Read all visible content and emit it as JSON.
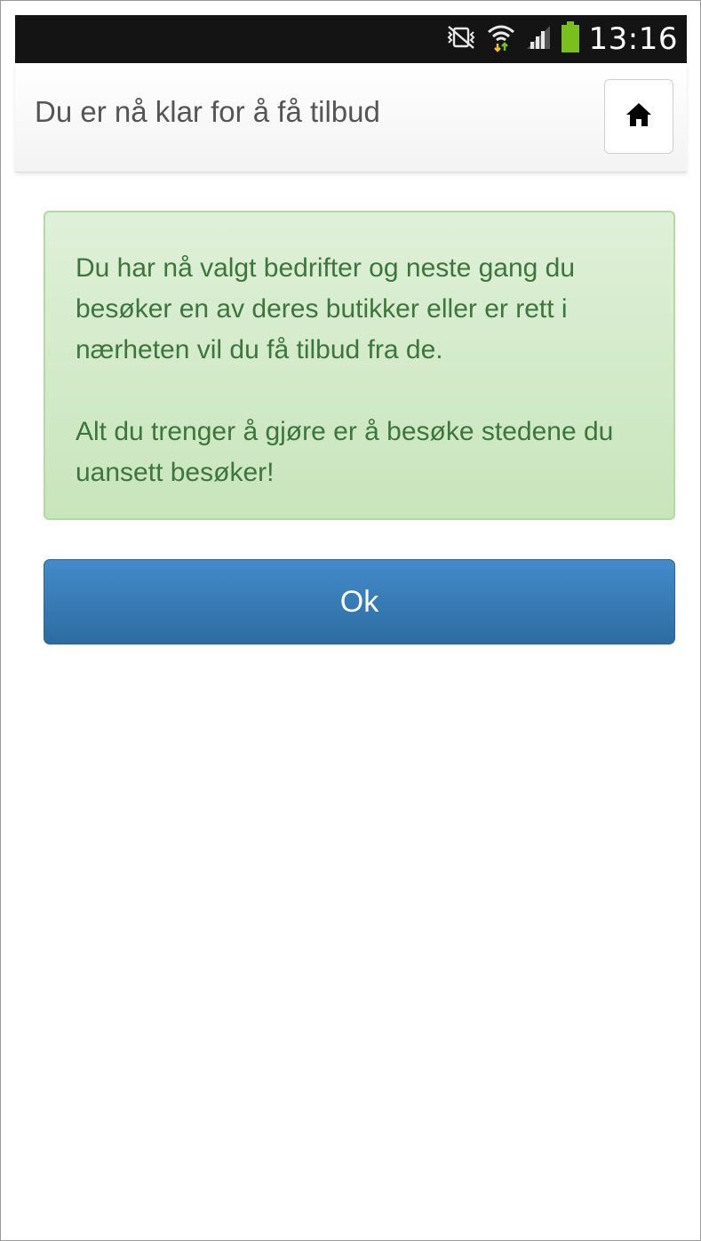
{
  "status_bar": {
    "time": "13:16",
    "icons": [
      "vibrate-mute-icon",
      "wifi-icon",
      "signal-icon",
      "battery-icon"
    ],
    "battery_color": "#7bbf1c",
    "wifi_arrow_colors": [
      "#f0c419",
      "#7bbf1c"
    ]
  },
  "header": {
    "title": "Du er nå klar for å få tilbud",
    "home_icon": "home-icon"
  },
  "alert": {
    "paragraph_1": "Du har nå valgt bedrifter og neste gang du besøker en av deres butikker eller er rett i nærheten vil du få tilbud fra de.",
    "paragraph_2": "Alt du trenger å gjøre er å besøke stedene du uansett besøker!",
    "text_color": "#3c763d",
    "background_color": "#dff0d8"
  },
  "ok_button": {
    "label": "Ok",
    "color": "#337ab7"
  }
}
